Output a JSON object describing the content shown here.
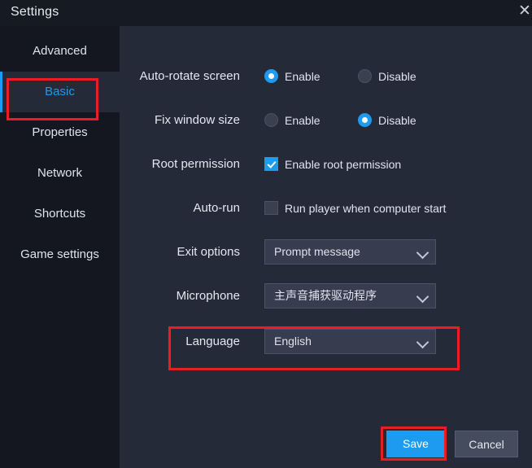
{
  "window": {
    "title": "Settings",
    "close_icon": "close-icon",
    "close_glyph": "✕"
  },
  "sidebar": {
    "items": [
      {
        "label": "Advanced",
        "active": false
      },
      {
        "label": "Basic",
        "active": true
      },
      {
        "label": "Properties",
        "active": false
      },
      {
        "label": "Network",
        "active": false
      },
      {
        "label": "Shortcuts",
        "active": false
      },
      {
        "label": "Game settings",
        "active": false
      }
    ]
  },
  "settings": {
    "auto_rotate": {
      "label": "Auto-rotate screen",
      "enable_label": "Enable",
      "disable_label": "Disable",
      "selected": "Enable"
    },
    "fix_window_size": {
      "label": "Fix window size",
      "enable_label": "Enable",
      "disable_label": "Disable",
      "selected": "Disable"
    },
    "root_permission": {
      "label": "Root permission",
      "checkbox_label": "Enable root permission",
      "checked": true
    },
    "auto_run": {
      "label": "Auto-run",
      "checkbox_label": "Run player when computer start",
      "checked": false
    },
    "exit_options": {
      "label": "Exit options",
      "value": "Prompt message",
      "chevron_icon": "chevron-down-icon"
    },
    "microphone": {
      "label": "Microphone",
      "value": "主声音捕获驱动程序",
      "chevron_icon": "chevron-down-icon"
    },
    "language": {
      "label": "Language",
      "value": "English",
      "chevron_icon": "chevron-down-icon",
      "highlighted": true
    }
  },
  "footer": {
    "save_label": "Save",
    "cancel_label": "Cancel"
  },
  "colors": {
    "accent_blue": "#1d9bf0",
    "annotation_red": "#ec1c24",
    "titlebar_bg": "#161a22",
    "sidebar_bg": "#14171f",
    "content_bg": "#252a38",
    "control_bg": "#373d4e",
    "cancel_bg": "#454c5e"
  }
}
